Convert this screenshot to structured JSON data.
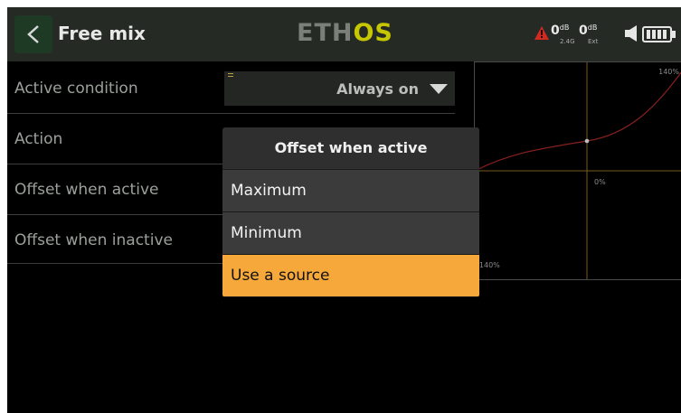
{
  "header": {
    "title": "Free mix",
    "logo_part1": "ETH",
    "logo_part2": "OS",
    "rf": [
      {
        "value": "0",
        "unit": "dB",
        "sub": "2.4G"
      },
      {
        "value": "0",
        "unit": "dB",
        "sub": "Ext"
      }
    ],
    "icons": [
      "back-chevron-icon",
      "warning-icon",
      "speaker-icon",
      "battery-icon"
    ]
  },
  "rows": [
    {
      "label": "Active condition"
    },
    {
      "label": "Action"
    },
    {
      "label": "Offset when active"
    },
    {
      "label": "Offset when inactive"
    }
  ],
  "active_condition": {
    "value": "Always on"
  },
  "graph": {
    "top_right": "140%",
    "center": "0%",
    "bottom_left": "-140%"
  },
  "popup": {
    "title": "Offset when active",
    "options": [
      {
        "label": "Maximum",
        "selected": false
      },
      {
        "label": "Minimum",
        "selected": false
      },
      {
        "label": "Use a source",
        "selected": true
      }
    ]
  },
  "colors": {
    "background": "#000000",
    "header": "#252a25",
    "logo_accent": "#c6c700",
    "selection": "#f6a83a",
    "curve": "#8a2020"
  }
}
